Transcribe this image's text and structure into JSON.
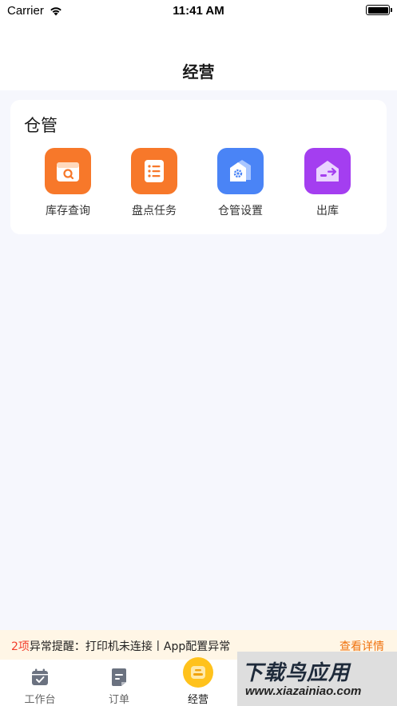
{
  "status_bar": {
    "carrier": "Carrier",
    "time": "11:41 AM",
    "wifi_icon": "wifi-icon",
    "battery_icon": "battery-icon"
  },
  "nav": {
    "title": "经营"
  },
  "warehouse": {
    "title": "仓管",
    "items": [
      {
        "label": "库存查询",
        "icon": "inventory-search-icon",
        "color": "#f7782a"
      },
      {
        "label": "盘点任务",
        "icon": "stocktake-list-icon",
        "color": "#f7782a"
      },
      {
        "label": "仓管设置",
        "icon": "warehouse-settings-icon",
        "color": "#4a84f6"
      },
      {
        "label": "出库",
        "icon": "outbound-icon",
        "color": "#a43ef0"
      }
    ]
  },
  "alert": {
    "count": "2项",
    "message": "异常提醒：打印机未连接丨App配置异常",
    "link": "查看详情"
  },
  "tabs": [
    {
      "label": "工作台",
      "icon": "calendar-check-icon",
      "active": false
    },
    {
      "label": "订单",
      "icon": "order-document-icon",
      "active": false
    },
    {
      "label": "经营",
      "icon": "business-icon",
      "active": true
    }
  ],
  "watermark": {
    "title": "下载鸟应用",
    "url": "www.xiazainiao.com"
  },
  "colors": {
    "background": "#f6f7fd",
    "accent_orange": "#f7782a",
    "accent_blue": "#4a84f6",
    "accent_purple": "#a43ef0",
    "alert_red": "#f23d2b",
    "alert_link": "#f0730f",
    "alert_bg": "#fff6e6"
  }
}
